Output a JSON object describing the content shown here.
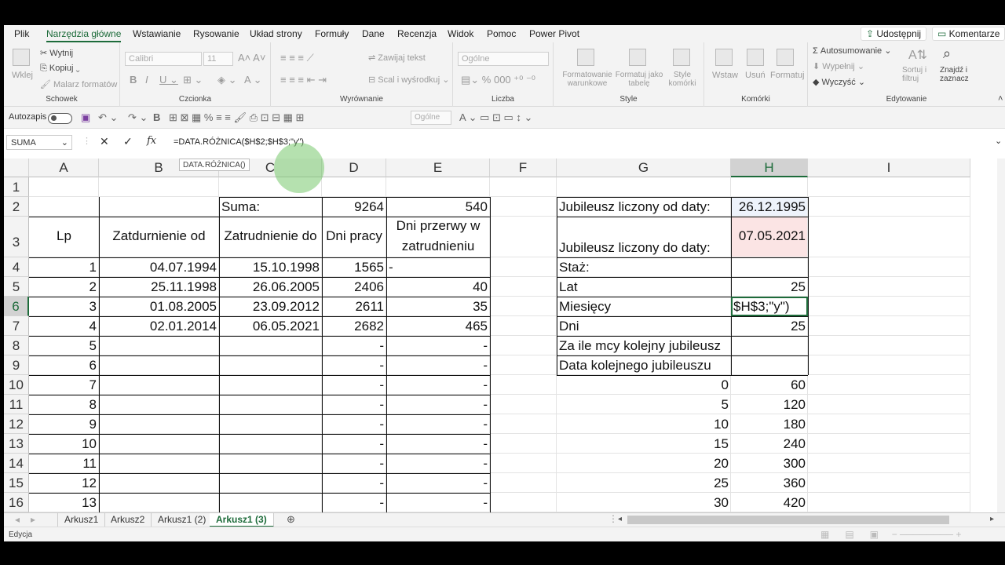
{
  "menu": {
    "tabs": [
      "Plik",
      "Narzędzia główne",
      "Wstawianie",
      "Rysowanie",
      "Układ strony",
      "Formuły",
      "Dane",
      "Recenzja",
      "Widok",
      "Pomoc",
      "Power Pivot"
    ],
    "share": "Udostępnij",
    "comments": "Komentarze"
  },
  "ribbon": {
    "paste": "Wklej",
    "cut": "Wytnij",
    "copy": "Kopiuj",
    "format_painter": "Malarz formatów",
    "clipboard": "Schowek",
    "font_name": "Calibri",
    "font_size": "11",
    "font_group": "Czcionka",
    "wrap_text": "Zawijaj tekst",
    "merge": "Scal i wyśrodkuj",
    "alignment": "Wyrównanie",
    "number_format": "Ogólne",
    "number": "Liczba",
    "cond_format": "Formatowanie warunkowe",
    "format_table": "Formatuj jako tabelę",
    "cell_styles": "Style komórki",
    "styles": "Style",
    "insert": "Wstaw",
    "delete": "Usuń",
    "format": "Formatuj",
    "cells": "Komórki",
    "autosum": "Autosumowanie",
    "fill": "Wypełnij",
    "clear": "Wyczyść",
    "sort": "Sortuj i filtruj",
    "find": "Znajdź i zaznacz",
    "editing": "Edytowanie"
  },
  "qat": {
    "autosave": "Autozapis",
    "number_format": "Ogólne"
  },
  "formula_bar": {
    "name_box": "SUMA",
    "formula": "=DATA.RÓŻNICA($H$2;$H$3;\"y\")",
    "tooltip": "DATA.RÓŻNICA()"
  },
  "columns": [
    "A",
    "B",
    "C",
    "D",
    "E",
    "F",
    "G",
    "H",
    "I"
  ],
  "rows": [
    "1",
    "2",
    "3",
    "4",
    "5",
    "6",
    "7",
    "8",
    "9",
    "10",
    "11",
    "12",
    "13",
    "14",
    "15",
    "16"
  ],
  "cells": {
    "C2": "Suma:",
    "D2": "9264",
    "E2": "540",
    "A3": "Lp",
    "B3": "Zatdurnienie od",
    "C3": "Zatrudnienie do",
    "D3": "Dni pracy",
    "E3a": "Dni przerwy w",
    "E3b": "zatrudnieniu",
    "A4": "1",
    "B4": "04.07.1994",
    "C4": "15.10.1998",
    "D4": "1565",
    "E4": "-",
    "A5": "2",
    "B5": "25.11.1998",
    "C5": "26.06.2005",
    "D5": "2406",
    "E5": "40",
    "A6": "3",
    "B6": "01.08.2005",
    "C6": "23.09.2012",
    "D6": "2611",
    "E6": "35",
    "A7": "4",
    "B7": "02.01.2014",
    "C7": "06.05.2021",
    "D7": "2682",
    "E7": "465",
    "A8": "5",
    "A9": "6",
    "A10": "7",
    "A11": "8",
    "A12": "9",
    "A13": "10",
    "A14": "11",
    "A15": "12",
    "A16": "13",
    "dash": "-",
    "G2": "Jubileusz liczony od daty:",
    "H2": "26.12.1995",
    "G3": "Jubileusz liczony do daty:",
    "H3": "07.05.2021",
    "G4": "Staż:",
    "G5": "Lat",
    "H5": "25",
    "G6": "Miesięcy",
    "H6": "$H$3;\"y\")",
    "G7": "Dni",
    "H7": "25",
    "G8": "Za ile mcy kolejny jubileusz",
    "G9": "Data kolejnego jubileuszu",
    "G10": "0",
    "H10": "60",
    "G11": "5",
    "H11": "120",
    "G12": "10",
    "H12": "180",
    "G13": "15",
    "H13": "240",
    "G14": "20",
    "H14": "300",
    "G15": "25",
    "H15": "360",
    "G16": "30",
    "H16": "420"
  },
  "sheets": [
    "Arkusz1",
    "Arkusz2",
    "Arkusz1 (2)",
    "Arkusz1 (3)"
  ],
  "status": "Edycja",
  "colors": {
    "accent": "#1d6b3a",
    "ribbon_bg": "#f3f3f3"
  }
}
